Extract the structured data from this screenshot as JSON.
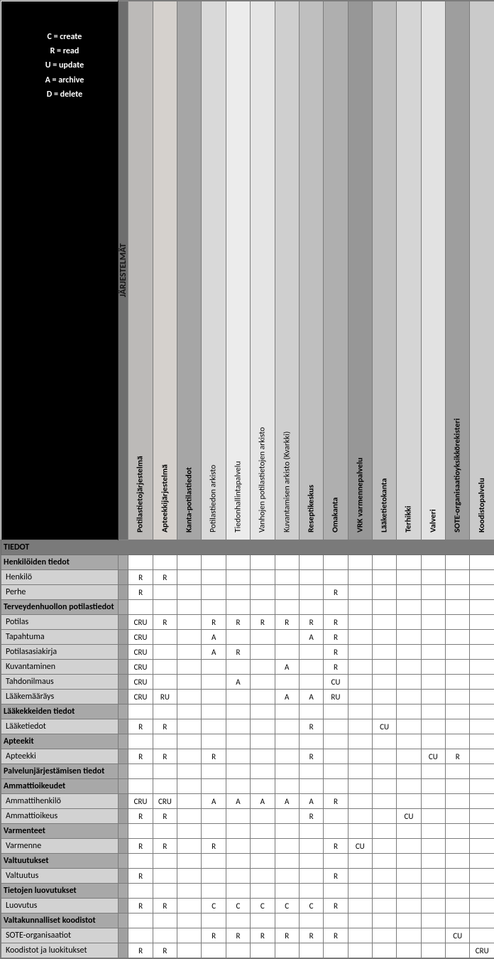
{
  "legend": {
    "C": "C = create",
    "R": "R = read",
    "U": "U = update",
    "A": "A = archive",
    "D": "D = delete"
  },
  "spacer_header": "JÄRJESTELMÄT",
  "columns": [
    {
      "label": "Potilastietojärjestelmä",
      "bold": true,
      "cls": "c1"
    },
    {
      "label": "Apteekkijärjestelmä",
      "bold": true,
      "cls": "c2"
    },
    {
      "label": "Kanta-potilastiedot",
      "bold": true,
      "cls": "c3"
    },
    {
      "label": "Potilastiedon arkisto",
      "bold": false,
      "cls": "c4"
    },
    {
      "label": "Tiedonhallintapalvelu",
      "bold": false,
      "cls": "c5"
    },
    {
      "label": "Vanhojen potilastietojen arkisto",
      "bold": false,
      "cls": "c6"
    },
    {
      "label": "Kuvantamisen arkisto (Kvarkki)",
      "bold": false,
      "cls": "c7"
    },
    {
      "label": "Reseptikeskus",
      "bold": true,
      "cls": "c8"
    },
    {
      "label": "Omakanta",
      "bold": true,
      "cls": "c9"
    },
    {
      "label": "VRK varmennepalvelu",
      "bold": true,
      "cls": "c10"
    },
    {
      "label": "Lääketietokanta",
      "bold": true,
      "cls": "c11"
    },
    {
      "label": "Terhikki",
      "bold": true,
      "cls": "c12"
    },
    {
      "label": "Valveri",
      "bold": true,
      "cls": "c13"
    },
    {
      "label": "SOTE-organisaatioyksikkörekisteri",
      "bold": true,
      "cls": "c14"
    },
    {
      "label": "Koodistopalvelu",
      "bold": true,
      "cls": "c15"
    }
  ],
  "section_title": "TIEDOT",
  "groups": [
    {
      "title": "Henkilöiden tiedot",
      "rows": [
        {
          "label": "Henkilö",
          "cells": [
            "R",
            "R",
            "",
            "",
            "",
            "",
            "",
            "",
            "",
            "",
            "",
            "",
            "",
            "",
            ""
          ]
        },
        {
          "label": "Perhe",
          "cells": [
            "R",
            "",
            "",
            "",
            "",
            "",
            "",
            "",
            "R",
            "",
            "",
            "",
            "",
            "",
            ""
          ]
        }
      ]
    },
    {
      "title": "Terveydenhuollon potilastiedot",
      "rows": [
        {
          "label": "Potilas",
          "cells": [
            "CRU",
            "R",
            "",
            "R",
            "R",
            "R",
            "R",
            "R",
            "R",
            "",
            "",
            "",
            "",
            "",
            ""
          ]
        },
        {
          "label": "Tapahtuma",
          "cells": [
            "CRU",
            "",
            "",
            "A",
            "",
            "",
            "",
            "A",
            "R",
            "",
            "",
            "",
            "",
            "",
            ""
          ]
        },
        {
          "label": "Potilasasiakirja",
          "cells": [
            "CRU",
            "",
            "",
            "A",
            "R",
            "",
            "",
            "",
            "R",
            "",
            "",
            "",
            "",
            "",
            ""
          ]
        },
        {
          "label": "Kuvantaminen",
          "cells": [
            "CRU",
            "",
            "",
            "",
            "",
            "",
            "A",
            "",
            "R",
            "",
            "",
            "",
            "",
            "",
            ""
          ]
        },
        {
          "label": "Tahdonilmaus",
          "cells": [
            "CRU",
            "",
            "",
            "",
            "A",
            "",
            "",
            "",
            "CU",
            "",
            "",
            "",
            "",
            "",
            ""
          ]
        },
        {
          "label": "Lääkemääräys",
          "cells": [
            "CRU",
            "RU",
            "",
            "",
            "",
            "",
            "A",
            "A",
            "RU",
            "",
            "",
            "",
            "",
            "",
            ""
          ]
        }
      ]
    },
    {
      "title": "Lääkekkeiden tiedot",
      "rows": [
        {
          "label": "Lääketiedot",
          "cells": [
            "R",
            "R",
            "",
            "",
            "",
            "",
            "",
            "R",
            "",
            "",
            "CU",
            "",
            "",
            "",
            ""
          ]
        }
      ]
    },
    {
      "title": "Apteekit",
      "rows": [
        {
          "label": "Apteekki",
          "cells": [
            "R",
            "R",
            "",
            "R",
            "",
            "",
            "",
            "R",
            "",
            "",
            "",
            "",
            "CU",
            "R",
            ""
          ]
        }
      ]
    },
    {
      "title": "Palvelunjärjestämisen tiedot",
      "rows": []
    },
    {
      "title": "Ammattioikeudet",
      "rows": [
        {
          "label": "Ammattihenkilö",
          "cells": [
            "CRU",
            "CRU",
            "",
            "A",
            "A",
            "A",
            "A",
            "A",
            "R",
            "",
            "",
            "",
            "",
            "",
            ""
          ]
        },
        {
          "label": "Ammattioikeus",
          "cells": [
            "R",
            "R",
            "",
            "",
            "",
            "",
            "",
            "R",
            "",
            "",
            "",
            "CU",
            "",
            "",
            ""
          ]
        }
      ]
    },
    {
      "title": "Varmenteet",
      "rows": [
        {
          "label": "Varmenne",
          "cells": [
            "R",
            "R",
            "",
            "R",
            "",
            "",
            "",
            "",
            "R",
            "CU",
            "",
            "",
            "",
            "",
            ""
          ]
        }
      ]
    },
    {
      "title": "Valtuutukset",
      "rows": [
        {
          "label": "Valtuutus",
          "cells": [
            "R",
            "",
            "",
            "",
            "",
            "",
            "",
            "",
            "R",
            "",
            "",
            "",
            "",
            "",
            ""
          ]
        }
      ]
    },
    {
      "title": "Tietojen luovutukset",
      "rows": [
        {
          "label": "Luovutus",
          "cells": [
            "R",
            "R",
            "",
            "C",
            "C",
            "C",
            "C",
            "C",
            "R",
            "",
            "",
            "",
            "",
            "",
            ""
          ]
        }
      ]
    },
    {
      "title": "Valtakunnalliset koodistot",
      "rows": [
        {
          "label": "SOTE-organisaatiot",
          "cells": [
            "",
            "",
            "",
            "R",
            "R",
            "R",
            "R",
            "R",
            "R",
            "",
            "",
            "",
            "",
            "CU",
            ""
          ]
        },
        {
          "label": "Koodistot ja luokitukset",
          "cells": [
            "R",
            "R",
            "",
            "",
            "",
            "",
            "",
            "",
            "",
            "",
            "",
            "",
            "",
            "",
            "CRU"
          ]
        }
      ]
    }
  ]
}
